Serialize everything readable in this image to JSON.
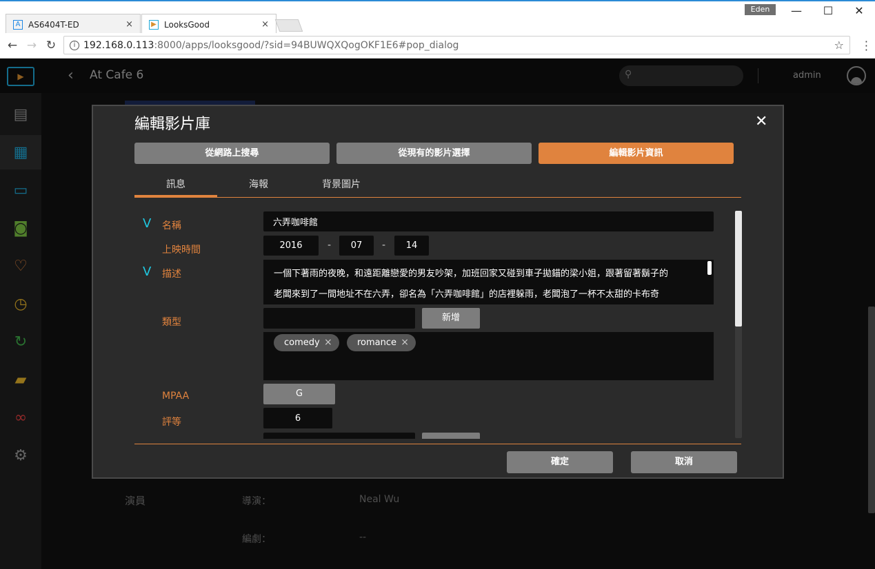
{
  "browser": {
    "tabs": [
      {
        "title": "AS6404T-ED",
        "close": "×"
      },
      {
        "title": "LooksGood",
        "close": "×"
      }
    ],
    "user": "Eden",
    "window_controls": {
      "minimize": "—",
      "maximize": "☐",
      "close": "✕"
    },
    "url_host": "192.168.0.113",
    "url_path": ":8000/apps/looksgood/?sid=94BUWQXQogOKF1E6#pop_dialog"
  },
  "app": {
    "breadcrumb": "At Cafe 6",
    "user": "admin",
    "sidebar_icons": [
      "storage-icon",
      "movie-icon",
      "tv-icon",
      "video-camera-icon",
      "heart-icon",
      "clock-icon",
      "recent-icon",
      "folder-icon",
      "recording-icon",
      "settings-icon"
    ],
    "background": {
      "section_label": "演員",
      "director_label": "導演：",
      "director_value": "Neal Wu",
      "writer_label": "編劇：",
      "writer_value": "--"
    }
  },
  "dialog": {
    "title": "編輯影片庫",
    "close": "✕",
    "segments": [
      {
        "label": "從網路上搜尋",
        "active": false
      },
      {
        "label": "從現有的影片選擇",
        "active": false
      },
      {
        "label": "編輯影片資訊",
        "active": true
      }
    ],
    "subtabs": [
      "訊息",
      "海報",
      "背景圖片"
    ],
    "active_subtab": "訊息",
    "form": {
      "check_mark": "V",
      "name_label": "名稱",
      "name_value": "六弄咖啡館",
      "release_label": "上映時間",
      "release_year": "2016",
      "release_month": "07",
      "release_day": "14",
      "date_separator": "-",
      "description_label": "描述",
      "description_line1": "一個下著雨的夜晚，和遠距離戀愛的男友吵架，加班回家又碰到車子拋錨的梁小姐，跟著留著鬍子的",
      "description_line2": "老闆來到了一間地址不在六弄，卻名為「六弄咖啡館」的店裡躲雨，老闆泡了一杯不太甜的卡布奇",
      "genre_label": "類型",
      "genre_input": "",
      "add_button": "新增",
      "tags": [
        {
          "label": "comedy",
          "remove": "×"
        },
        {
          "label": "romance",
          "remove": "×"
        }
      ],
      "mpaa_label": "MPAA",
      "mpaa_value": "G",
      "rating_label": "評等",
      "rating_value": "6"
    },
    "confirm": "確定",
    "cancel": "取消",
    "accent_color": "#e0833e",
    "check_color": "#1fc7e0"
  }
}
